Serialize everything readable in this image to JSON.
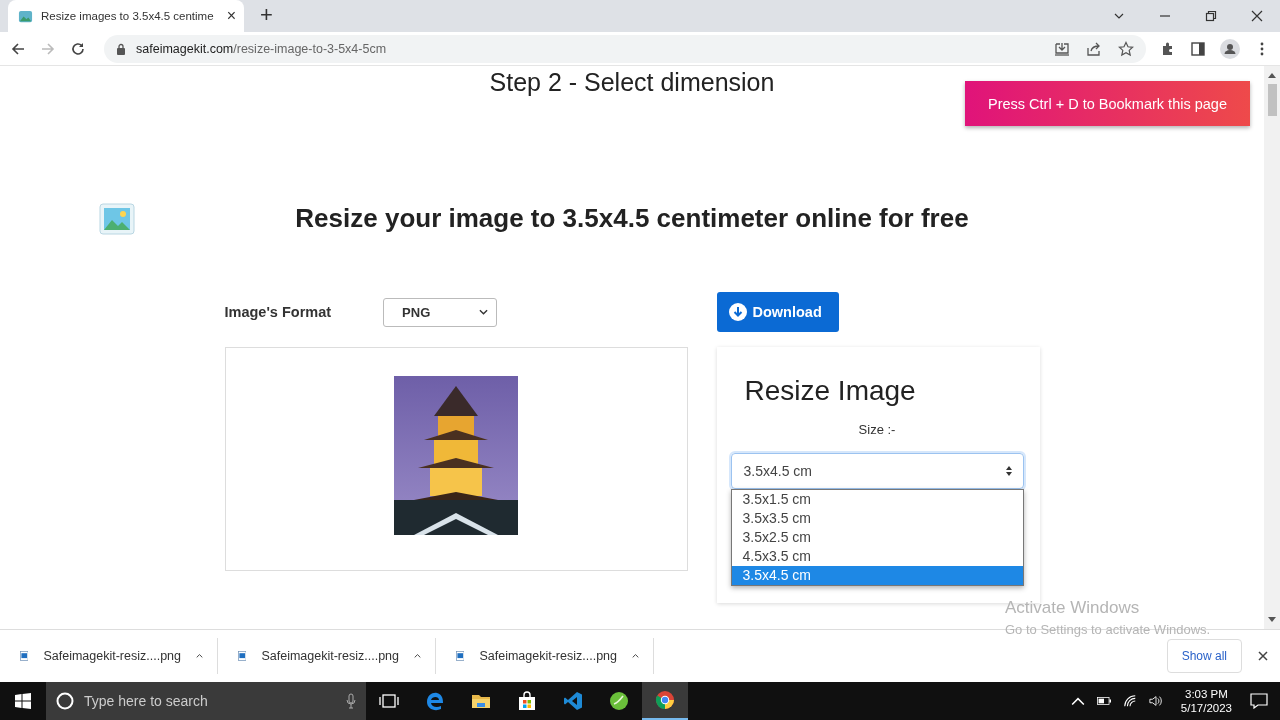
{
  "browser": {
    "tab": {
      "title": "Resize images to 3.5x4.5 centime",
      "close": "×"
    },
    "new_tab": "+",
    "url": {
      "domain": "safeimagekit.com",
      "path": "/resize-image-to-3-5x4-5cm"
    }
  },
  "page": {
    "step_title": "Step 2 - Select dimension",
    "bookmark_banner": "Press Ctrl + D to Bookmark this page",
    "heading": "Resize your image to 3.5x4.5 centimeter online for free",
    "format": {
      "label": "Image's Format",
      "value": "PNG"
    },
    "download_button": "Download",
    "resize": {
      "title": "Resize Image",
      "size_label": "Size :-",
      "value": "3.5x4.5 cm",
      "options": [
        {
          "label": "3.5x1.5 cm",
          "selected": false
        },
        {
          "label": "3.5x3.5 cm",
          "selected": false
        },
        {
          "label": "3.5x2.5 cm",
          "selected": false
        },
        {
          "label": "4.5x3.5 cm",
          "selected": false
        },
        {
          "label": "3.5x4.5 cm",
          "selected": true
        }
      ]
    }
  },
  "downloads": [
    {
      "name": "Safeimagekit-resiz....png"
    },
    {
      "name": "Safeimagekit-resiz....png"
    },
    {
      "name": "Safeimagekit-resiz....png"
    }
  ],
  "show_all": "Show all",
  "os_notice": {
    "title": "Activate Windows",
    "subtitle": "Go to Settings to activate Windows."
  },
  "taskbar": {
    "search_placeholder": "Type here to search",
    "time": "3:03 PM",
    "date": "5/17/2023"
  }
}
